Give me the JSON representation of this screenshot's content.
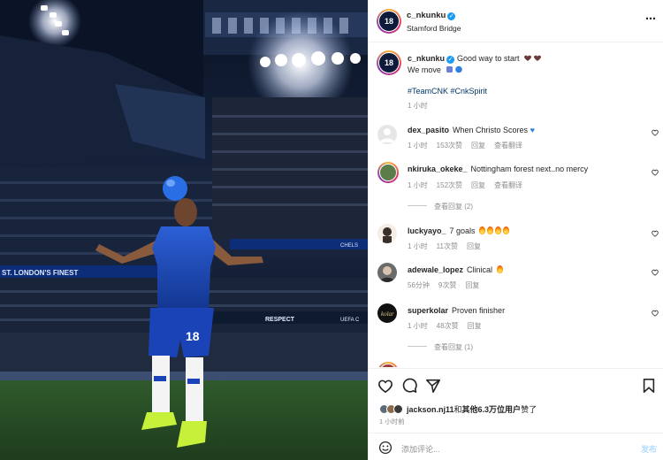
{
  "post": {
    "username": "c_nkunku",
    "location": "Stamford Bridge",
    "caption_text": "Good way to start",
    "caption_line2": "We move",
    "hashtags": "#TeamCNK #CnkSpirit",
    "caption_time": "1 小时",
    "more_icon": "⋯"
  },
  "photo": {
    "shirt_number": "18",
    "banner_text": "ST. LONDON'S FINEST",
    "respect_text": "RESPECT",
    "uefa_text": "UEFA C",
    "chelsea_text": "CHELS",
    "avatar_text": "18"
  },
  "comments": [
    {
      "user": "dex_pasito",
      "text": "When Christo Scores",
      "time": "1 小时",
      "likes": "153次赞",
      "reply": "回复",
      "translate": "查看翻译",
      "avatar": "#d9d9d9",
      "emoji": "blue-heart"
    },
    {
      "user": "nkiruka_okeke_",
      "text": "Nottingham forest next..no mercy",
      "time": "1 小时",
      "likes": "152次赞",
      "reply": "回复",
      "translate": "查看翻译",
      "avatar": "#5b7d4a",
      "view_replies": "查看回复 (2)"
    },
    {
      "user": "luckyayo_",
      "text": "7 goals",
      "time": "1 小时",
      "likes": "11次赞",
      "reply": "回复",
      "avatar": "#3a2f28",
      "emoji": "fire-x4"
    },
    {
      "user": "adewale_lopez",
      "text": "Clinical",
      "time": "56分钟",
      "likes": "9次赞",
      "reply": "回复",
      "avatar": "#6b6b6b",
      "emoji": "fire"
    },
    {
      "user": "superkolar",
      "text": "Proven finisher",
      "time": "1 小时",
      "likes": "48次赞",
      "reply": "回复",
      "avatar": "#1a1a1a",
      "view_replies": "查看回复 (1)"
    }
  ],
  "actions": {
    "liked_by_user": "jackson.nj11",
    "liked_by_mid": "和",
    "liked_by_others": "其他6.3万位用户",
    "liked_by_tail": "赞了",
    "time": "1 小时前",
    "comment_placeholder": "添加评论...",
    "post_label": "发布"
  },
  "colors": {
    "accent": "#0095f6",
    "verified": "#1d9bf0",
    "link": "#00376b",
    "muted": "#8e8e8e"
  }
}
